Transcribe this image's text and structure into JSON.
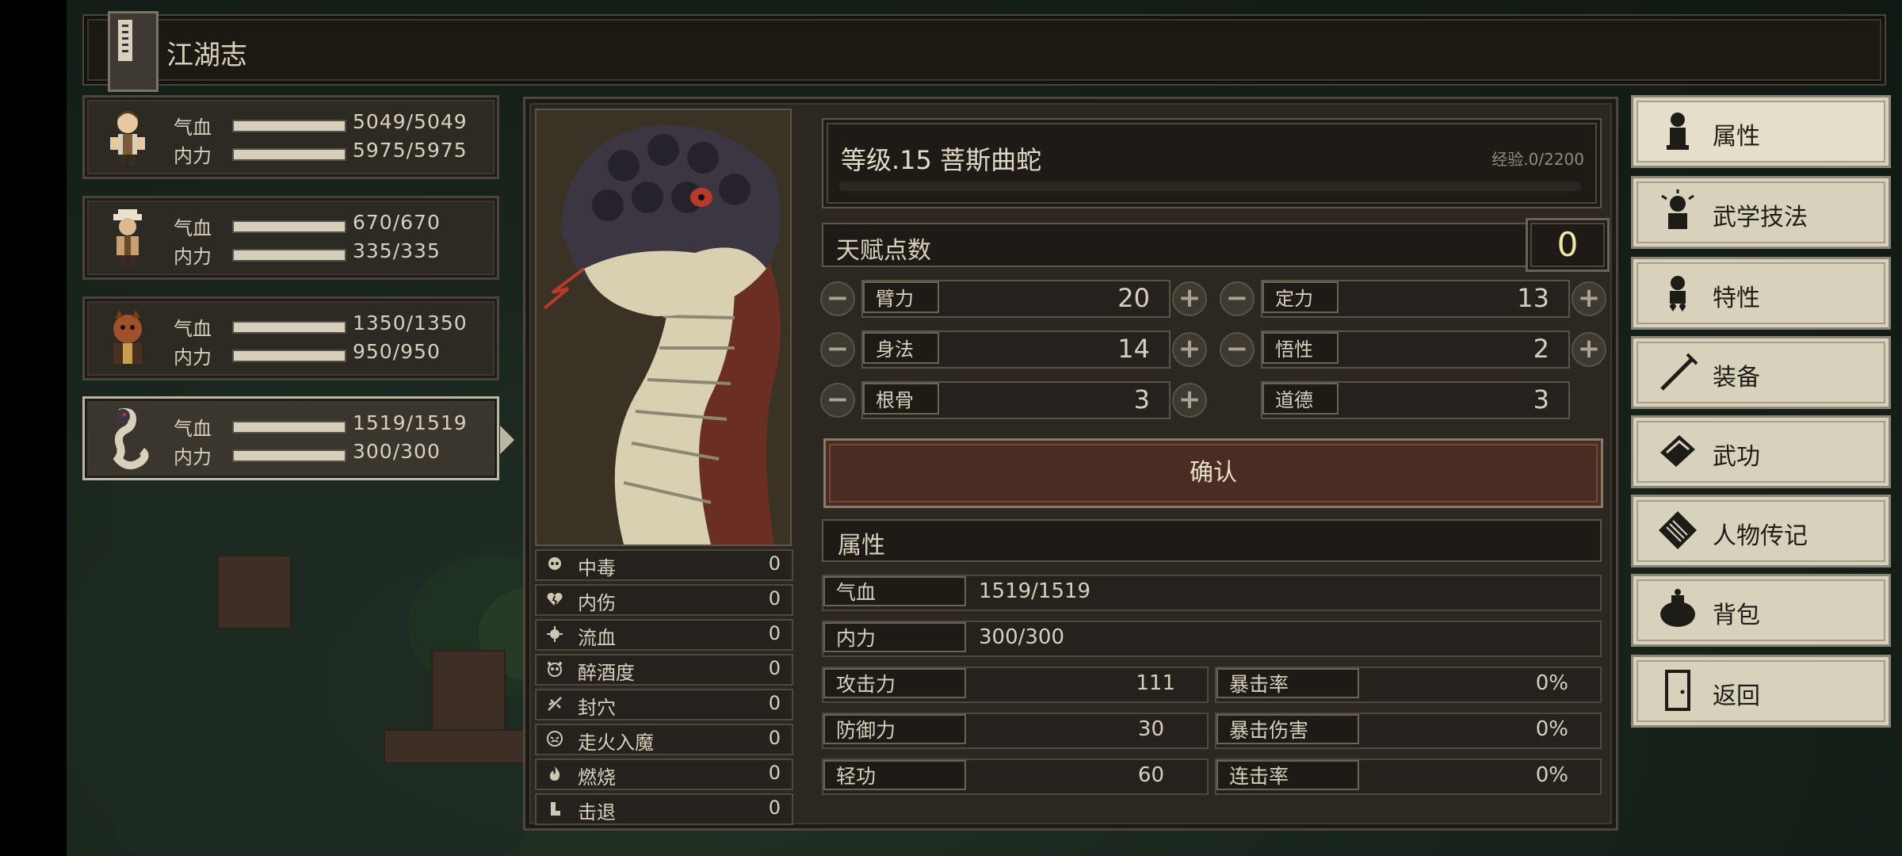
{
  "title": "江湖志",
  "party": [
    {
      "hp_label": "气血",
      "hp": "5049/5049",
      "hp_fill": 1.0,
      "mp_label": "内力",
      "mp": "5975/5975",
      "mp_fill": 1.0
    },
    {
      "hp_label": "气血",
      "hp": "670/670",
      "hp_fill": 1.0,
      "mp_label": "内力",
      "mp": "335/335",
      "mp_fill": 1.0
    },
    {
      "hp_label": "气血",
      "hp": "1350/1350",
      "hp_fill": 1.0,
      "mp_label": "内力",
      "mp": "950/950",
      "mp_fill": 1.0
    },
    {
      "hp_label": "气血",
      "hp": "1519/1519",
      "hp_fill": 1.0,
      "mp_label": "内力",
      "mp": "300/300",
      "mp_fill": 1.0
    }
  ],
  "character": {
    "level_text": "等级.15  菩斯曲蛇",
    "exp_text": "经验.0/2200",
    "exp_fill": 0.0,
    "talent_label": "天赋点数",
    "talent_value": "0"
  },
  "base_attrs": {
    "strength": {
      "label": "臂力",
      "value": "20"
    },
    "focus": {
      "label": "定力",
      "value": "13"
    },
    "agility": {
      "label": "身法",
      "value": "14"
    },
    "insight": {
      "label": "悟性",
      "value": "2"
    },
    "constitution": {
      "label": "根骨",
      "value": "3"
    },
    "morality": {
      "label": "道德",
      "value": "3"
    }
  },
  "confirm_label": "确认",
  "status_effects": [
    {
      "name": "中毒",
      "value": "0",
      "icon": "skull-icon"
    },
    {
      "name": "内伤",
      "value": "0",
      "icon": "broken-heart-icon"
    },
    {
      "name": "流血",
      "value": "0",
      "icon": "blood-icon"
    },
    {
      "name": "醉酒度",
      "value": "0",
      "icon": "drunk-icon"
    },
    {
      "name": "封穴",
      "value": "0",
      "icon": "acupoint-icon"
    },
    {
      "name": "走火入魔",
      "value": "0",
      "icon": "demon-icon"
    },
    {
      "name": "燃烧",
      "value": "0",
      "icon": "fire-icon"
    },
    {
      "name": "击退",
      "value": "0",
      "icon": "knockback-icon"
    }
  ],
  "attributes": {
    "header": "属性",
    "hp": {
      "label": "气血",
      "value": "1519/1519"
    },
    "mp": {
      "label": "内力",
      "value": "300/300"
    },
    "attack": {
      "label": "攻击力",
      "value": "111"
    },
    "crit_rate": {
      "label": "暴击率",
      "value": "0%"
    },
    "defense": {
      "label": "防御力",
      "value": "30"
    },
    "crit_dmg": {
      "label": "暴击伤害",
      "value": "0%"
    },
    "qinggong": {
      "label": "轻功",
      "value": "60"
    },
    "combo_rate": {
      "label": "连击率",
      "value": "0%"
    }
  },
  "menu": [
    {
      "label": "属性",
      "icon": "attribute-icon",
      "selected": true
    },
    {
      "label": "武学技法",
      "icon": "martial-skill-icon",
      "selected": false
    },
    {
      "label": "特性",
      "icon": "trait-icon",
      "selected": false
    },
    {
      "label": "装备",
      "icon": "sword-icon",
      "selected": false
    },
    {
      "label": "武功",
      "icon": "manual-icon",
      "selected": false
    },
    {
      "label": "人物传记",
      "icon": "biography-icon",
      "selected": false
    },
    {
      "label": "背包",
      "icon": "bag-icon",
      "selected": false
    },
    {
      "label": "返回",
      "icon": "door-icon",
      "selected": false
    }
  ],
  "colors": {
    "accent": "#d8d2bd",
    "confirm": "#4a2c22",
    "panel": "#2c2721"
  }
}
